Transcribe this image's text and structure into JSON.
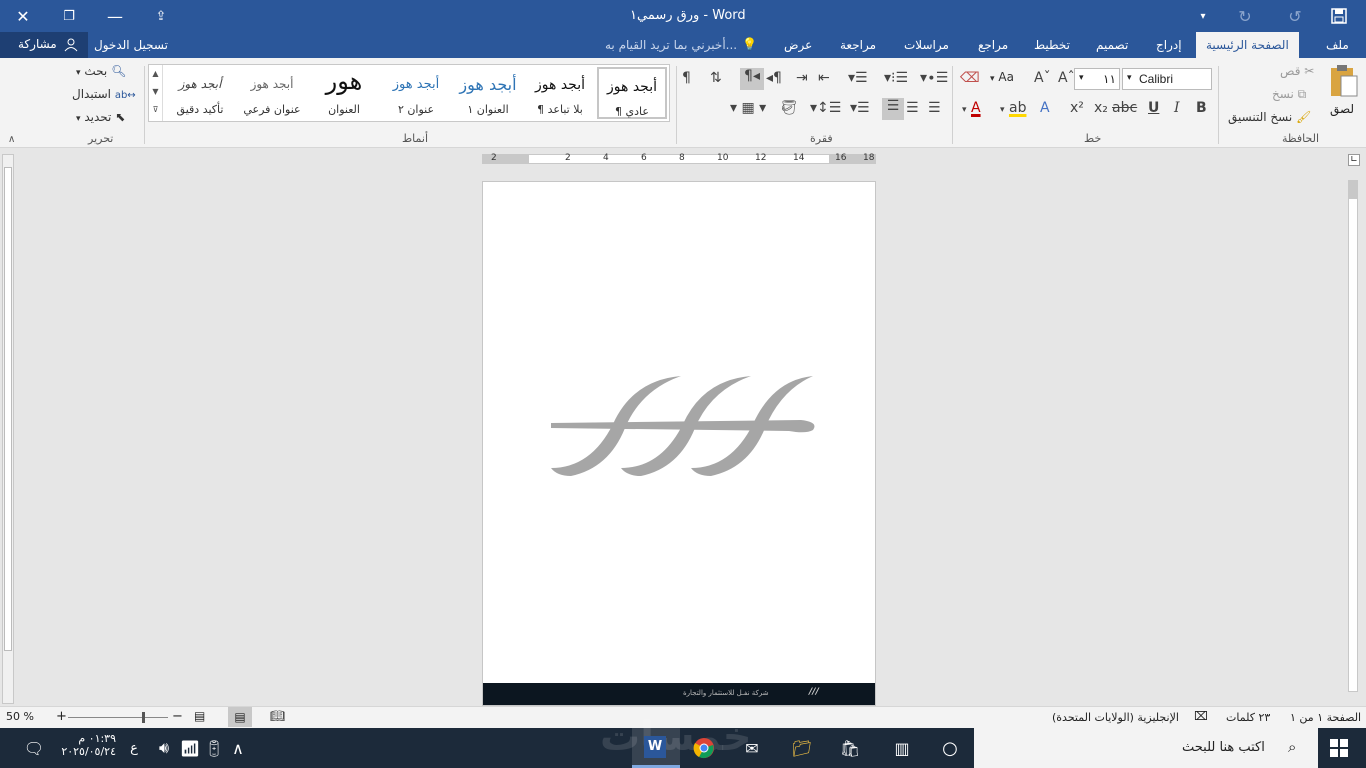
{
  "title_bar": {
    "title": "ورق رسمي١ - Word"
  },
  "tabs": {
    "file": "ملف",
    "home": "الصفحة الرئيسية",
    "insert": "إدراج",
    "design": "تصميم",
    "layout": "تخطيط",
    "references": "مراجع",
    "mailings": "مراسلات",
    "review": "مراجعة",
    "view": "عرض",
    "tell_me": "أخبرني بما تريد القيام به...",
    "sign_in": "تسجيل الدخول",
    "share": "مشاركة"
  },
  "clipboard": {
    "paste": "لصق",
    "cut": "قص",
    "copy": "نسخ",
    "format_painter": "نسخ التنسيق",
    "group": "الحافظة"
  },
  "font": {
    "name": "Calibri",
    "size": "١١",
    "group": "خط",
    "bold": "B",
    "italic": "I",
    "underline": "U",
    "change_case": "Aa"
  },
  "paragraph": {
    "group": "فقرة"
  },
  "styles": {
    "group": "أنماط",
    "items": [
      {
        "sample": "أبجد هوز",
        "name": "¶ عادي"
      },
      {
        "sample": "أبجد هوز",
        "name": "¶ بلا تباعد"
      },
      {
        "sample": "أبجد هوز",
        "name": "العنوان ١"
      },
      {
        "sample": "أبجد هوز",
        "name": "عنوان ٢"
      },
      {
        "sample": "هور",
        "name": "العنوان"
      },
      {
        "sample": "أبجد هوز",
        "name": "عنوان فرعي"
      },
      {
        "sample": "أبجد هوز",
        "name": "تأكيد دقيق"
      }
    ]
  },
  "editing": {
    "find": "بحث",
    "replace": "استبدال",
    "select": "تحديد",
    "group": "تحرير"
  },
  "ruler": {
    "ticks": [
      "18",
      "16",
      "14",
      "12",
      "10",
      "8",
      "6",
      "4",
      "2",
      "2"
    ]
  },
  "document": {
    "footer_text": "شركة نفـل للاستثمار والتجارة",
    "logo_color": "#a6a6a6"
  },
  "status_bar": {
    "page": "الصفحة ١ من ١",
    "words": "٢٣ كلمات",
    "language": "الإنجليزية (الولايات المتحدة)",
    "zoom": "50 %"
  },
  "taskbar": {
    "search_placeholder": "اكتب هنا للبحث",
    "time": "٠١:٣٩ م",
    "date": "٢٠٢٥/٠٥/٢٤",
    "lang": "ع",
    "watermark": "خمسات"
  },
  "colors": {
    "accent": "#2b579a"
  }
}
